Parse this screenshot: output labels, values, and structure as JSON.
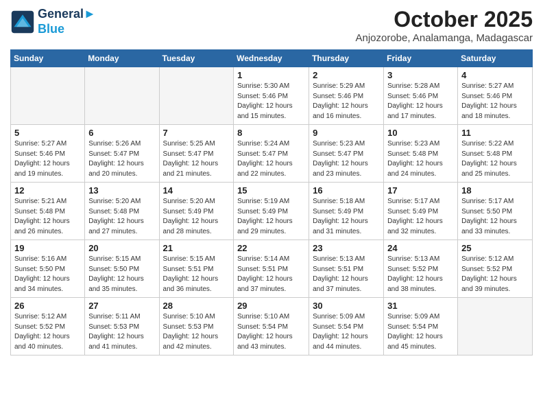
{
  "logo": {
    "line1": "General",
    "line2": "Blue"
  },
  "title": "October 2025",
  "subtitle": "Anjozorobe, Analamanga, Madagascar",
  "days_of_week": [
    "Sunday",
    "Monday",
    "Tuesday",
    "Wednesday",
    "Thursday",
    "Friday",
    "Saturday"
  ],
  "weeks": [
    [
      {
        "num": "",
        "info": ""
      },
      {
        "num": "",
        "info": ""
      },
      {
        "num": "",
        "info": ""
      },
      {
        "num": "1",
        "info": "Sunrise: 5:30 AM\nSunset: 5:46 PM\nDaylight: 12 hours\nand 15 minutes."
      },
      {
        "num": "2",
        "info": "Sunrise: 5:29 AM\nSunset: 5:46 PM\nDaylight: 12 hours\nand 16 minutes."
      },
      {
        "num": "3",
        "info": "Sunrise: 5:28 AM\nSunset: 5:46 PM\nDaylight: 12 hours\nand 17 minutes."
      },
      {
        "num": "4",
        "info": "Sunrise: 5:27 AM\nSunset: 5:46 PM\nDaylight: 12 hours\nand 18 minutes."
      }
    ],
    [
      {
        "num": "5",
        "info": "Sunrise: 5:27 AM\nSunset: 5:46 PM\nDaylight: 12 hours\nand 19 minutes."
      },
      {
        "num": "6",
        "info": "Sunrise: 5:26 AM\nSunset: 5:47 PM\nDaylight: 12 hours\nand 20 minutes."
      },
      {
        "num": "7",
        "info": "Sunrise: 5:25 AM\nSunset: 5:47 PM\nDaylight: 12 hours\nand 21 minutes."
      },
      {
        "num": "8",
        "info": "Sunrise: 5:24 AM\nSunset: 5:47 PM\nDaylight: 12 hours\nand 22 minutes."
      },
      {
        "num": "9",
        "info": "Sunrise: 5:23 AM\nSunset: 5:47 PM\nDaylight: 12 hours\nand 23 minutes."
      },
      {
        "num": "10",
        "info": "Sunrise: 5:23 AM\nSunset: 5:48 PM\nDaylight: 12 hours\nand 24 minutes."
      },
      {
        "num": "11",
        "info": "Sunrise: 5:22 AM\nSunset: 5:48 PM\nDaylight: 12 hours\nand 25 minutes."
      }
    ],
    [
      {
        "num": "12",
        "info": "Sunrise: 5:21 AM\nSunset: 5:48 PM\nDaylight: 12 hours\nand 26 minutes."
      },
      {
        "num": "13",
        "info": "Sunrise: 5:20 AM\nSunset: 5:48 PM\nDaylight: 12 hours\nand 27 minutes."
      },
      {
        "num": "14",
        "info": "Sunrise: 5:20 AM\nSunset: 5:49 PM\nDaylight: 12 hours\nand 28 minutes."
      },
      {
        "num": "15",
        "info": "Sunrise: 5:19 AM\nSunset: 5:49 PM\nDaylight: 12 hours\nand 29 minutes."
      },
      {
        "num": "16",
        "info": "Sunrise: 5:18 AM\nSunset: 5:49 PM\nDaylight: 12 hours\nand 31 minutes."
      },
      {
        "num": "17",
        "info": "Sunrise: 5:17 AM\nSunset: 5:49 PM\nDaylight: 12 hours\nand 32 minutes."
      },
      {
        "num": "18",
        "info": "Sunrise: 5:17 AM\nSunset: 5:50 PM\nDaylight: 12 hours\nand 33 minutes."
      }
    ],
    [
      {
        "num": "19",
        "info": "Sunrise: 5:16 AM\nSunset: 5:50 PM\nDaylight: 12 hours\nand 34 minutes."
      },
      {
        "num": "20",
        "info": "Sunrise: 5:15 AM\nSunset: 5:50 PM\nDaylight: 12 hours\nand 35 minutes."
      },
      {
        "num": "21",
        "info": "Sunrise: 5:15 AM\nSunset: 5:51 PM\nDaylight: 12 hours\nand 36 minutes."
      },
      {
        "num": "22",
        "info": "Sunrise: 5:14 AM\nSunset: 5:51 PM\nDaylight: 12 hours\nand 37 minutes."
      },
      {
        "num": "23",
        "info": "Sunrise: 5:13 AM\nSunset: 5:51 PM\nDaylight: 12 hours\nand 37 minutes."
      },
      {
        "num": "24",
        "info": "Sunrise: 5:13 AM\nSunset: 5:52 PM\nDaylight: 12 hours\nand 38 minutes."
      },
      {
        "num": "25",
        "info": "Sunrise: 5:12 AM\nSunset: 5:52 PM\nDaylight: 12 hours\nand 39 minutes."
      }
    ],
    [
      {
        "num": "26",
        "info": "Sunrise: 5:12 AM\nSunset: 5:52 PM\nDaylight: 12 hours\nand 40 minutes."
      },
      {
        "num": "27",
        "info": "Sunrise: 5:11 AM\nSunset: 5:53 PM\nDaylight: 12 hours\nand 41 minutes."
      },
      {
        "num": "28",
        "info": "Sunrise: 5:10 AM\nSunset: 5:53 PM\nDaylight: 12 hours\nand 42 minutes."
      },
      {
        "num": "29",
        "info": "Sunrise: 5:10 AM\nSunset: 5:54 PM\nDaylight: 12 hours\nand 43 minutes."
      },
      {
        "num": "30",
        "info": "Sunrise: 5:09 AM\nSunset: 5:54 PM\nDaylight: 12 hours\nand 44 minutes."
      },
      {
        "num": "31",
        "info": "Sunrise: 5:09 AM\nSunset: 5:54 PM\nDaylight: 12 hours\nand 45 minutes."
      },
      {
        "num": "",
        "info": ""
      }
    ]
  ]
}
